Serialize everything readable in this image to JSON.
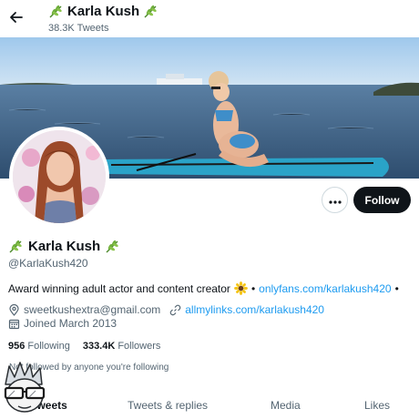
{
  "header": {
    "title": "Karla Kush",
    "tweets_count": "38.3K Tweets",
    "back_icon": "arrow-left-icon",
    "title_emoji": "herb-icon"
  },
  "actions": {
    "more_icon": "more-horizontal-icon",
    "follow_label": "Follow"
  },
  "profile": {
    "name": "Karla Kush",
    "handle": "@KarlaKush420",
    "bio_text": "Award winning adult actor and content creator",
    "bio_emoji": "sunflower-icon",
    "bio_separator": "•",
    "bio_link": "onlyfans.com/karlakush420",
    "bio_trailing": "•",
    "email": "sweetkushextra@gmail.com",
    "website": "allmylinks.com/karlakush420",
    "joined": "Joined March 2013",
    "following_count": "956",
    "following_label": "Following",
    "followers_count": "333.4K",
    "followers_label": "Followers",
    "followed_by": "Not followed by anyone you're following"
  },
  "tabs": [
    "Tweets",
    "Tweets & replies",
    "Media",
    "Likes"
  ],
  "colors": {
    "accent": "#1d9bf0",
    "follow_button": "#0f1419",
    "secondary_text": "#536471"
  }
}
